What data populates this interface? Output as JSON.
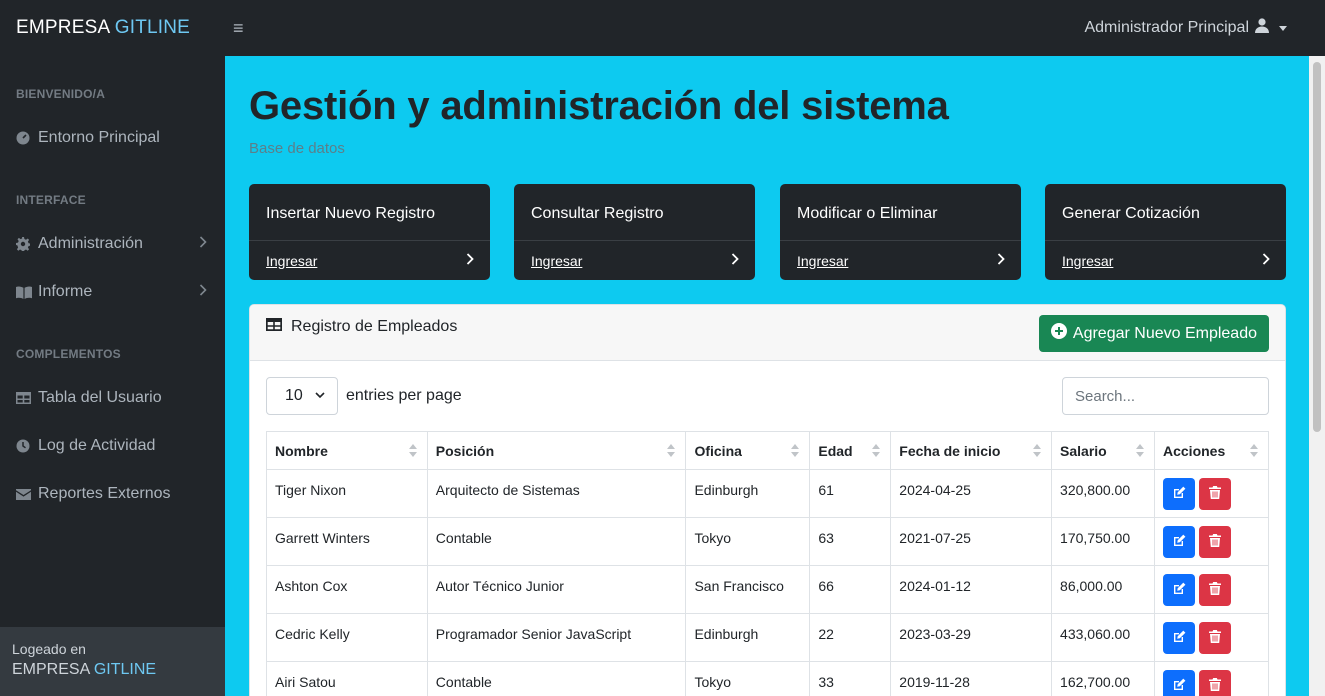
{
  "brand": {
    "name": "EMPRESA",
    "accent": "GITLINE"
  },
  "user_menu": {
    "label": "Administrador Principal"
  },
  "sidebar": {
    "sections": [
      {
        "heading": "BIENVENIDO/A"
      },
      {
        "heading": "INTERFACE"
      },
      {
        "heading": "COMPLEMENTOS"
      }
    ],
    "items": [
      {
        "label": "Entorno Principal",
        "icon": "dashboard-icon"
      },
      {
        "label": "Administración",
        "icon": "gear-icon"
      },
      {
        "label": "Informe",
        "icon": "book-icon"
      },
      {
        "label": "Tabla del Usuario",
        "icon": "table-icon"
      },
      {
        "label": "Log de Actividad",
        "icon": "clock-icon"
      },
      {
        "label": "Reportes Externos",
        "icon": "envelope-icon"
      }
    ],
    "footer": {
      "small": "Logeado en",
      "name": "EMPRESA",
      "accent": "GITLINE"
    }
  },
  "page": {
    "title": "Gestión y administración del sistema",
    "subtitle": "Base de datos"
  },
  "cards": [
    {
      "title": "Insertar Nuevo Registro",
      "link": "Ingresar"
    },
    {
      "title": "Consultar Registro",
      "link": "Ingresar"
    },
    {
      "title": "Modificar o Eliminar",
      "link": "Ingresar"
    },
    {
      "title": "Generar Cotización",
      "link": "Ingresar"
    }
  ],
  "table_card": {
    "title": "Registro de Empleados",
    "add_button": "Agregar Nuevo Empleado",
    "per_page_value": "10",
    "per_page_label": "entries per page",
    "search_placeholder": "Search...",
    "columns": [
      "Nombre",
      "Posición",
      "Oficina",
      "Edad",
      "Fecha de inicio",
      "Salario",
      "Acciones"
    ],
    "rows": [
      [
        "Tiger Nixon",
        "Arquitecto de Sistemas",
        "Edinburgh",
        "61",
        "2024-04-25",
        "320,800.00"
      ],
      [
        "Garrett Winters",
        "Contable",
        "Tokyo",
        "63",
        "2021-07-25",
        "170,750.00"
      ],
      [
        "Ashton Cox",
        "Autor Técnico Junior",
        "San Francisco",
        "66",
        "2024-01-12",
        "86,000.00"
      ],
      [
        "Cedric Kelly",
        "Programador Senior JavaScript",
        "Edinburgh",
        "22",
        "2023-03-29",
        "433,060.00"
      ],
      [
        "Airi Satou",
        "Contable",
        "Tokyo",
        "33",
        "2019-11-28",
        "162,700.00"
      ]
    ]
  },
  "colors": {
    "accent": "#0dcaf0",
    "dark": "#212529",
    "success": "#198754",
    "primary": "#0d6efd",
    "danger": "#dc3545"
  }
}
